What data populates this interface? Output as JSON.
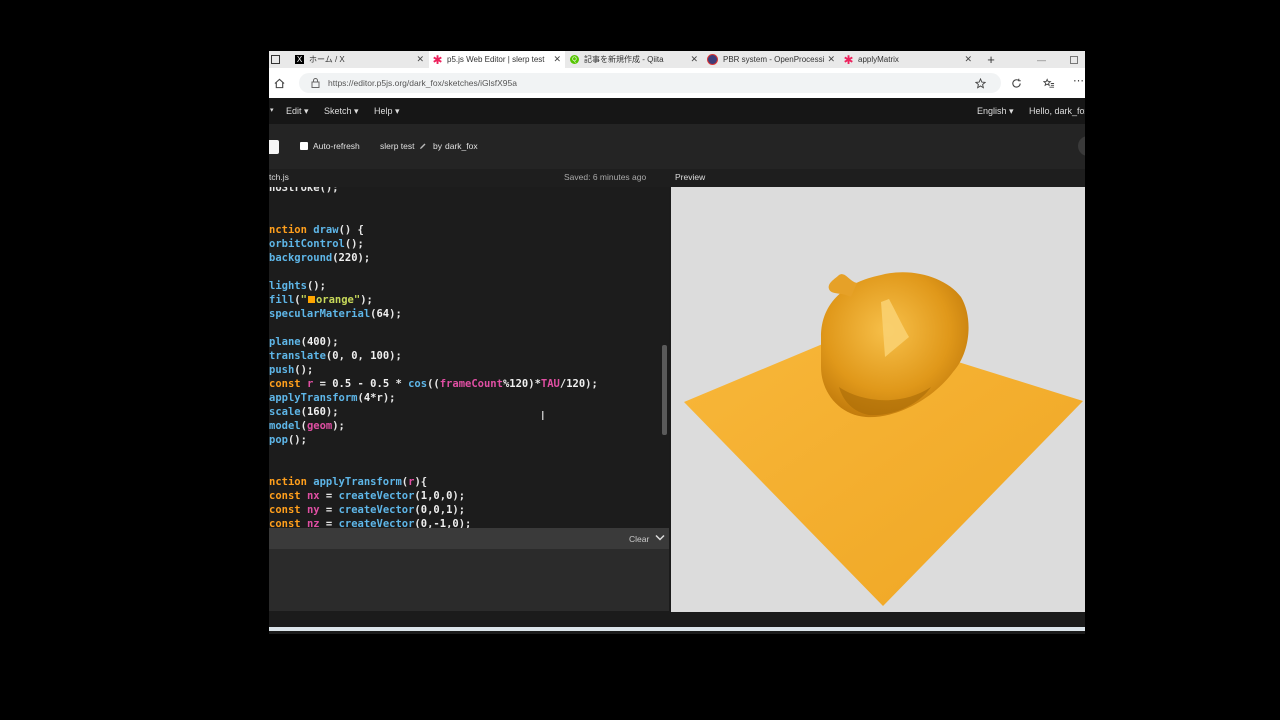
{
  "browser": {
    "tabs": [
      {
        "title": "ホーム / X",
        "icon": "x-logo-icon",
        "active": false
      },
      {
        "title": "p5.js Web Editor | slerp test",
        "icon": "p5-asterisk-icon",
        "active": true
      },
      {
        "title": "記事を新規作成 - Qiita",
        "icon": "qiita-icon",
        "active": false
      },
      {
        "title": "PBR system - OpenProcessi",
        "icon": "openprocessing-icon",
        "active": false
      },
      {
        "title": "applyMatrix",
        "icon": "p5-asterisk-icon",
        "active": false
      }
    ],
    "new_tab": "+",
    "url": "https://editor.p5js.org/dark_fox/sketches/iGlsfX95a"
  },
  "editor_app": {
    "menu": {
      "edit": "Edit ▾",
      "sketch": "Sketch ▾",
      "help": "Help ▾",
      "language": "English ▾",
      "user": "Hello, dark_fox"
    },
    "toolbar": {
      "auto_refresh": "Auto-refresh",
      "auto_refresh_checked": false,
      "sketch_name": "slerp test",
      "by": "by",
      "author": "dark_fox"
    },
    "file_tab": "tch.js",
    "saved_status": "Saved: 6 minutes ago",
    "preview_label": "Preview",
    "console_clear": "Clear",
    "fill_color": "#ffa500",
    "accent_color": "#ed225d"
  },
  "code_lines": [
    [
      [
        "tx",
        "noStroke();"
      ]
    ],
    [],
    [],
    [
      [
        "kw",
        "nction "
      ],
      [
        "fn",
        "draw"
      ],
      [
        "tx",
        "() {"
      ]
    ],
    [
      [
        "fn",
        "orbitControl"
      ],
      [
        "tx",
        "();"
      ]
    ],
    [
      [
        "fn",
        "background"
      ],
      [
        "tx",
        "("
      ],
      [
        "nm",
        "220"
      ],
      [
        "tx",
        ");"
      ]
    ],
    [],
    [
      [
        "fn",
        "lights"
      ],
      [
        "tx",
        "();"
      ]
    ],
    [
      [
        "fn",
        "fill"
      ],
      [
        "tx",
        "("
      ],
      [
        "st",
        "\""
      ],
      [
        "sw",
        ""
      ],
      [
        "st",
        "orange\""
      ],
      [
        "tx",
        ");"
      ]
    ],
    [
      [
        "fn",
        "specularMaterial"
      ],
      [
        "tx",
        "("
      ],
      [
        "nm",
        "64"
      ],
      [
        "tx",
        ");"
      ]
    ],
    [],
    [
      [
        "fn",
        "plane"
      ],
      [
        "tx",
        "("
      ],
      [
        "nm",
        "400"
      ],
      [
        "tx",
        ");"
      ]
    ],
    [
      [
        "fn",
        "translate"
      ],
      [
        "tx",
        "("
      ],
      [
        "nm",
        "0"
      ],
      [
        "tx",
        ", "
      ],
      [
        "nm",
        "0"
      ],
      [
        "tx",
        ", "
      ],
      [
        "nm",
        "100"
      ],
      [
        "tx",
        ");"
      ]
    ],
    [
      [
        "fn",
        "push"
      ],
      [
        "tx",
        "();"
      ]
    ],
    [
      [
        "kw",
        "const "
      ],
      [
        "vr",
        "r"
      ],
      [
        "tx",
        " = "
      ],
      [
        "nm",
        "0.5"
      ],
      [
        "tx",
        " - "
      ],
      [
        "nm",
        "0.5"
      ],
      [
        "tx",
        " * "
      ],
      [
        "fn",
        "cos"
      ],
      [
        "tx",
        "(("
      ],
      [
        "vr",
        "frameCount"
      ],
      [
        "tx",
        "%"
      ],
      [
        "nm",
        "120"
      ],
      [
        "tx",
        ")*"
      ],
      [
        "vr",
        "TAU"
      ],
      [
        "tx",
        "/"
      ],
      [
        "nm",
        "120"
      ],
      [
        "tx",
        ");"
      ]
    ],
    [
      [
        "fn",
        "applyTransform"
      ],
      [
        "tx",
        "("
      ],
      [
        "nm",
        "4"
      ],
      [
        "tx",
        "*r);"
      ]
    ],
    [
      [
        "fn",
        "scale"
      ],
      [
        "tx",
        "("
      ],
      [
        "nm",
        "160"
      ],
      [
        "tx",
        ");"
      ]
    ],
    [
      [
        "fn",
        "model"
      ],
      [
        "tx",
        "("
      ],
      [
        "vr",
        "geom"
      ],
      [
        "tx",
        ");"
      ]
    ],
    [
      [
        "fn",
        "pop"
      ],
      [
        "tx",
        "();"
      ]
    ],
    [],
    [],
    [
      [
        "kw",
        "nction "
      ],
      [
        "fn",
        "applyTransform"
      ],
      [
        "tx",
        "("
      ],
      [
        "vr",
        "r"
      ],
      [
        "tx",
        "){"
      ]
    ],
    [
      [
        "kw",
        "const "
      ],
      [
        "vr",
        "nx"
      ],
      [
        "tx",
        " = "
      ],
      [
        "fn",
        "createVector"
      ],
      [
        "tx",
        "("
      ],
      [
        "nm",
        "1"
      ],
      [
        "tx",
        ","
      ],
      [
        "nm",
        "0"
      ],
      [
        "tx",
        ","
      ],
      [
        "nm",
        "0"
      ],
      [
        "tx",
        ");"
      ]
    ],
    [
      [
        "kw",
        "const "
      ],
      [
        "vr",
        "ny"
      ],
      [
        "tx",
        " = "
      ],
      [
        "fn",
        "createVector"
      ],
      [
        "tx",
        "("
      ],
      [
        "nm",
        "0"
      ],
      [
        "tx",
        ","
      ],
      [
        "nm",
        "0"
      ],
      [
        "tx",
        ","
      ],
      [
        "nm",
        "1"
      ],
      [
        "tx",
        ");"
      ]
    ],
    [
      [
        "kw",
        "const "
      ],
      [
        "vr",
        "nz"
      ],
      [
        "tx",
        " = "
      ],
      [
        "fn",
        "createVector"
      ],
      [
        "tx",
        "("
      ],
      [
        "nm",
        "0"
      ],
      [
        "tx",
        ",-"
      ],
      [
        "nm",
        "1"
      ],
      [
        "tx",
        ","
      ],
      [
        "nm",
        "0"
      ],
      [
        "tx",
        ");"
      ]
    ]
  ]
}
